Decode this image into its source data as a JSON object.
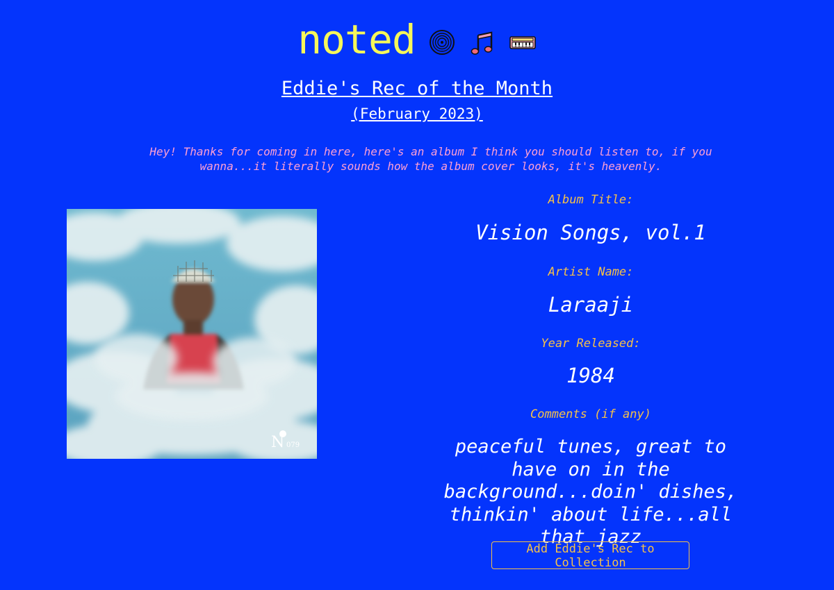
{
  "header": {
    "logo": "noted",
    "icons": [
      "vinyl-record-icon",
      "music-notes-icon",
      "keyboard-icon"
    ]
  },
  "rec": {
    "title": "Eddie's Rec of the Month",
    "date": "(February 2023)",
    "intro": "Hey! Thanks for coming in here, here's an album I think you should listen to, if you wanna...it literally sounds how the album cover looks, it's heavenly."
  },
  "album": {
    "cover_alt": "Album cover artwork",
    "cover_badge": "079",
    "title_label": "Album Title:",
    "title": "Vision Songs, vol.1",
    "artist_label": "Artist Name:",
    "artist": "Laraaji",
    "year_label": "Year Released:",
    "year": "1984",
    "comments_label": "Comments (if any)",
    "comments": "peaceful tunes, great to have on in the background...doin' dishes, thinkin' about life...all that jazz"
  },
  "actions": {
    "add_label": "Add Eddie's Rec to Collection"
  },
  "colors": {
    "background": "#0434fc",
    "logo": "#f6f75a",
    "intro": "#ff9fd4",
    "label": "#f5c14a",
    "text": "#ffffff"
  }
}
